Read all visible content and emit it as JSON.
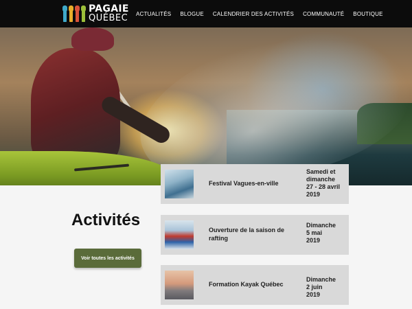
{
  "logo": {
    "line1": "PAGAIE",
    "line2": "QUÉBEC",
    "paddle_colors": [
      "#3fa9c9",
      "#e8ad2a",
      "#d9533a",
      "#9cbf3a"
    ]
  },
  "nav": {
    "items": [
      "ACTUALITÉS",
      "BLOGUE",
      "CALENDRIER DES ACTIVITÉS",
      "COMMUNAUTÉ",
      "BOUTIQUE"
    ]
  },
  "activities": {
    "heading": "Activités",
    "button_label": "Voir toutes les activités"
  },
  "events": [
    {
      "title": "Festival Vagues-en-ville",
      "date_day": "Samedi et dimanche",
      "date_main": "27 - 28 avril",
      "year": "2019",
      "thumb_icon": "kayak-surf-photo"
    },
    {
      "title": "Ouverture de la saison de rafting",
      "date_day": "Dimanche",
      "date_main": "5 mai",
      "year": "2019",
      "thumb_icon": "rafting-photo"
    },
    {
      "title": "Formation Kayak Québec",
      "date_day": "Dimanche",
      "date_main": "2 juin",
      "year": "2019",
      "thumb_icon": "sunset-kayak-photo"
    }
  ],
  "colors": {
    "header_bg": "#0c0c0c",
    "card_bg": "#d9d9d9",
    "button_bg": "#5a6b3a",
    "page_bg": "#f5f5f5"
  }
}
